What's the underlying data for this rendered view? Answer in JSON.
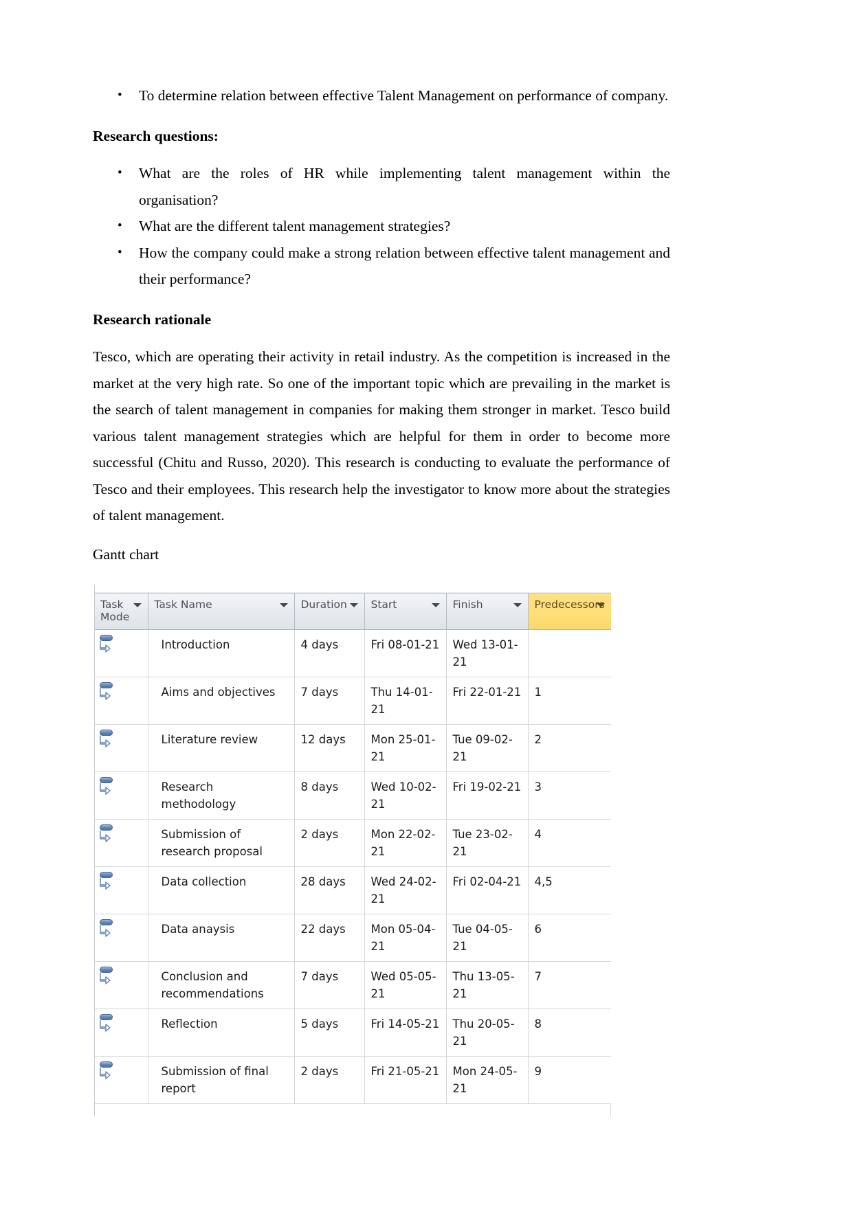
{
  "document": {
    "objective_bullet": "To determine relation between effective Talent Management on performance of company.",
    "research_questions_heading": "Research questions:",
    "research_questions": [
      "What are the roles of HR while implementing talent management within the organisation?",
      "What are the different talent management strategies?",
      "How the company could make a strong relation between effective talent management and their performance?"
    ],
    "research_rationale_heading": "Research rationale",
    "research_rationale_paragraph": "Tesco, which are operating their activity in retail industry. As the competition is increased in the market at the very high rate. So one of the important topic which are prevailing in the market is the search of talent management in companies for making them stronger in market. Tesco build various talent management strategies which are helpful for them in order to become more successful (Chitu and Russo, 2020). This research is conducting to evaluate the performance of Tesco and their employees. This research help the investigator to know more about the strategies of talent management.",
    "gantt_chart_caption": "Gantt chart"
  },
  "gantt_table": {
    "columns": [
      {
        "id": "task_mode",
        "label_line1": "Task",
        "label_line2": "Mode",
        "highlighted": false
      },
      {
        "id": "task_name",
        "label_line1": "Task Name",
        "label_line2": "",
        "highlighted": false
      },
      {
        "id": "duration",
        "label_line1": "Duration",
        "label_line2": "",
        "highlighted": false
      },
      {
        "id": "start",
        "label_line1": "Start",
        "label_line2": "",
        "highlighted": false
      },
      {
        "id": "finish",
        "label_line1": "Finish",
        "label_line2": "",
        "highlighted": false
      },
      {
        "id": "predecessors",
        "label_line1": "Predecessors",
        "label_line2": "",
        "highlighted": true
      }
    ],
    "highlight_color": "#ffdf78",
    "task_mode_icon": "manually-scheduled-icon",
    "rows": [
      {
        "mode_icon": "manually-scheduled-icon",
        "name": "Introduction",
        "duration": "4 days",
        "start": "Fri 08-01-21",
        "finish": "Wed 13-01-21",
        "predecessors": ""
      },
      {
        "mode_icon": "manually-scheduled-icon",
        "name": "Aims and objectives",
        "duration": "7 days",
        "start": "Thu 14-01-21",
        "finish": "Fri 22-01-21",
        "predecessors": "1"
      },
      {
        "mode_icon": "manually-scheduled-icon",
        "name": "Literature review",
        "duration": "12 days",
        "start": "Mon 25-01-21",
        "finish": "Tue 09-02-21",
        "predecessors": "2"
      },
      {
        "mode_icon": "manually-scheduled-icon",
        "name": "Research methodology",
        "duration": "8 days",
        "start": "Wed 10-02-21",
        "finish": "Fri 19-02-21",
        "predecessors": "3"
      },
      {
        "mode_icon": "manually-scheduled-icon",
        "name": "Submission of research proposal",
        "duration": "2 days",
        "start": "Mon 22-02-21",
        "finish": "Tue 23-02-21",
        "predecessors": "4"
      },
      {
        "mode_icon": "manually-scheduled-icon",
        "name": "Data collection",
        "duration": "28 days",
        "start": "Wed 24-02-21",
        "finish": "Fri 02-04-21",
        "predecessors": "4,5"
      },
      {
        "mode_icon": "manually-scheduled-icon",
        "name": "Data anaysis",
        "duration": "22 days",
        "start": "Mon 05-04-21",
        "finish": "Tue 04-05-21",
        "predecessors": "6"
      },
      {
        "mode_icon": "manually-scheduled-icon",
        "name": "Conclusion and recommendations",
        "duration": "7 days",
        "start": "Wed 05-05-21",
        "finish": "Thu 13-05-21",
        "predecessors": "7"
      },
      {
        "mode_icon": "manually-scheduled-icon",
        "name": "Reflection",
        "duration": "5 days",
        "start": "Fri 14-05-21",
        "finish": "Thu 20-05-21",
        "predecessors": "8"
      },
      {
        "mode_icon": "manually-scheduled-icon",
        "name": "Submission of final report",
        "duration": "2 days",
        "start": "Fri 21-05-21",
        "finish": "Mon 24-05-21",
        "predecessors": "9"
      }
    ]
  }
}
